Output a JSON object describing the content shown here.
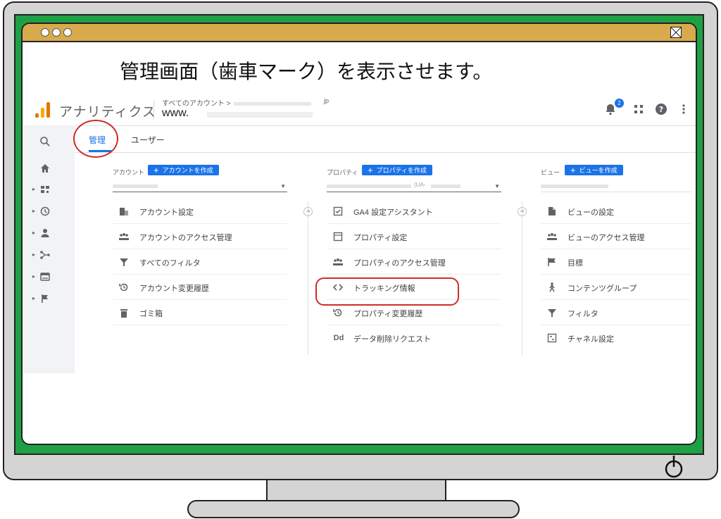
{
  "headline": "管理画面（歯車マーク）を表示させます。",
  "header": {
    "app_name": "アナリティクス",
    "breadcrumb": "すべてのアカウント >",
    "breadcrumb_suffix": "jp",
    "property_name": "www.",
    "notification_count": "2"
  },
  "tabs": [
    {
      "label": "管理",
      "active": true
    },
    {
      "label": "ユーザー",
      "active": false
    }
  ],
  "account": {
    "label": "アカウント",
    "create_button": "アカウントを作成",
    "items": [
      {
        "icon": "building-icon",
        "label": "アカウント設定"
      },
      {
        "icon": "people-icon",
        "label": "アカウントのアクセス管理"
      },
      {
        "icon": "filter-icon",
        "label": "すべてのフィルタ"
      },
      {
        "icon": "history-icon",
        "label": "アカウント変更履歴"
      },
      {
        "icon": "trash-icon",
        "label": "ゴミ箱"
      }
    ]
  },
  "property": {
    "label": "プロパティ",
    "create_button": "プロパティを作成",
    "selected_suffix": "(UA-",
    "items": [
      {
        "icon": "checkbox-icon",
        "label": "GA4 設定アシスタント"
      },
      {
        "icon": "layout-icon",
        "label": "プロパティ設定"
      },
      {
        "icon": "people-icon",
        "label": "プロパティのアクセス管理"
      },
      {
        "icon": "code-icon",
        "label": "トラッキング情報"
      },
      {
        "icon": "history-icon",
        "label": "プロパティ変更履歴"
      },
      {
        "icon": "dd-icon",
        "label": "データ削除リクエスト"
      }
    ]
  },
  "view": {
    "label": "ビュー",
    "create_button": "ビューを作成",
    "items": [
      {
        "icon": "document-icon",
        "label": "ビューの設定"
      },
      {
        "icon": "people-icon",
        "label": "ビューのアクセス管理"
      },
      {
        "icon": "flag-icon",
        "label": "目標"
      },
      {
        "icon": "person-walk-icon",
        "label": "コンテンツグループ"
      },
      {
        "icon": "filter-icon",
        "label": "フィルタ"
      },
      {
        "icon": "channel-icon",
        "label": "チャネル設定"
      }
    ]
  },
  "colors": {
    "bezel": "#1ea044",
    "titlebar": "#d9aa4c",
    "accent": "#1a73e8",
    "highlight": "#d12b2b"
  }
}
